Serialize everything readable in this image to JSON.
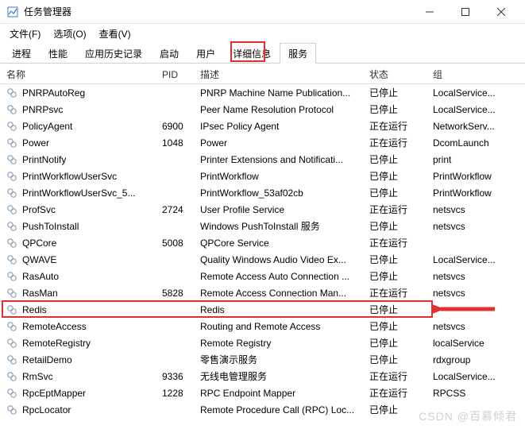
{
  "window": {
    "title": "任务管理器"
  },
  "menu": {
    "file": "文件(F)",
    "options": "选项(O)",
    "view": "查看(V)"
  },
  "tabs": {
    "processes": "进程",
    "performance": "性能",
    "apphist": "应用历史记录",
    "startup": "启动",
    "users": "用户",
    "details": "详细信息",
    "services": "服务"
  },
  "columns": {
    "name": "名称",
    "pid": "PID",
    "desc": "描述",
    "status": "状态",
    "group": "组"
  },
  "rows": [
    {
      "name": "PNRPAutoReg",
      "pid": "",
      "desc": "PNRP Machine Name Publication...",
      "status": "已停止",
      "group": "LocalService..."
    },
    {
      "name": "PNRPsvc",
      "pid": "",
      "desc": "Peer Name Resolution Protocol",
      "status": "已停止",
      "group": "LocalService..."
    },
    {
      "name": "PolicyAgent",
      "pid": "6900",
      "desc": "IPsec Policy Agent",
      "status": "正在运行",
      "group": "NetworkServ..."
    },
    {
      "name": "Power",
      "pid": "1048",
      "desc": "Power",
      "status": "正在运行",
      "group": "DcomLaunch"
    },
    {
      "name": "PrintNotify",
      "pid": "",
      "desc": "Printer Extensions and Notificati...",
      "status": "已停止",
      "group": "print"
    },
    {
      "name": "PrintWorkflowUserSvc",
      "pid": "",
      "desc": "PrintWorkflow",
      "status": "已停止",
      "group": "PrintWorkflow"
    },
    {
      "name": "PrintWorkflowUserSvc_5...",
      "pid": "",
      "desc": "PrintWorkflow_53af02cb",
      "status": "已停止",
      "group": "PrintWorkflow"
    },
    {
      "name": "ProfSvc",
      "pid": "2724",
      "desc": "User Profile Service",
      "status": "正在运行",
      "group": "netsvcs"
    },
    {
      "name": "PushToInstall",
      "pid": "",
      "desc": "Windows PushToInstall 服务",
      "status": "已停止",
      "group": "netsvcs"
    },
    {
      "name": "QPCore",
      "pid": "5008",
      "desc": "QPCore Service",
      "status": "正在运行",
      "group": ""
    },
    {
      "name": "QWAVE",
      "pid": "",
      "desc": "Quality Windows Audio Video Ex...",
      "status": "已停止",
      "group": "LocalService..."
    },
    {
      "name": "RasAuto",
      "pid": "",
      "desc": "Remote Access Auto Connection ...",
      "status": "已停止",
      "group": "netsvcs"
    },
    {
      "name": "RasMan",
      "pid": "5828",
      "desc": "Remote Access Connection Man...",
      "status": "正在运行",
      "group": "netsvcs"
    },
    {
      "name": "Redis",
      "pid": "",
      "desc": "Redis",
      "status": "已停止",
      "group": ""
    },
    {
      "name": "RemoteAccess",
      "pid": "",
      "desc": "Routing and Remote Access",
      "status": "已停止",
      "group": "netsvcs"
    },
    {
      "name": "RemoteRegistry",
      "pid": "",
      "desc": "Remote Registry",
      "status": "已停止",
      "group": "localService"
    },
    {
      "name": "RetailDemo",
      "pid": "",
      "desc": "零售演示服务",
      "status": "已停止",
      "group": "rdxgroup"
    },
    {
      "name": "RmSvc",
      "pid": "9336",
      "desc": "无线电管理服务",
      "status": "正在运行",
      "group": "LocalService..."
    },
    {
      "name": "RpcEptMapper",
      "pid": "1228",
      "desc": "RPC Endpoint Mapper",
      "status": "正在运行",
      "group": "RPCSS"
    },
    {
      "name": "RpcLocator",
      "pid": "",
      "desc": "Remote Procedure Call (RPC) Loc...",
      "status": "已停止",
      "group": ""
    }
  ],
  "watermark": "CSDN @百慕倾君",
  "highlight_row_index": 13
}
